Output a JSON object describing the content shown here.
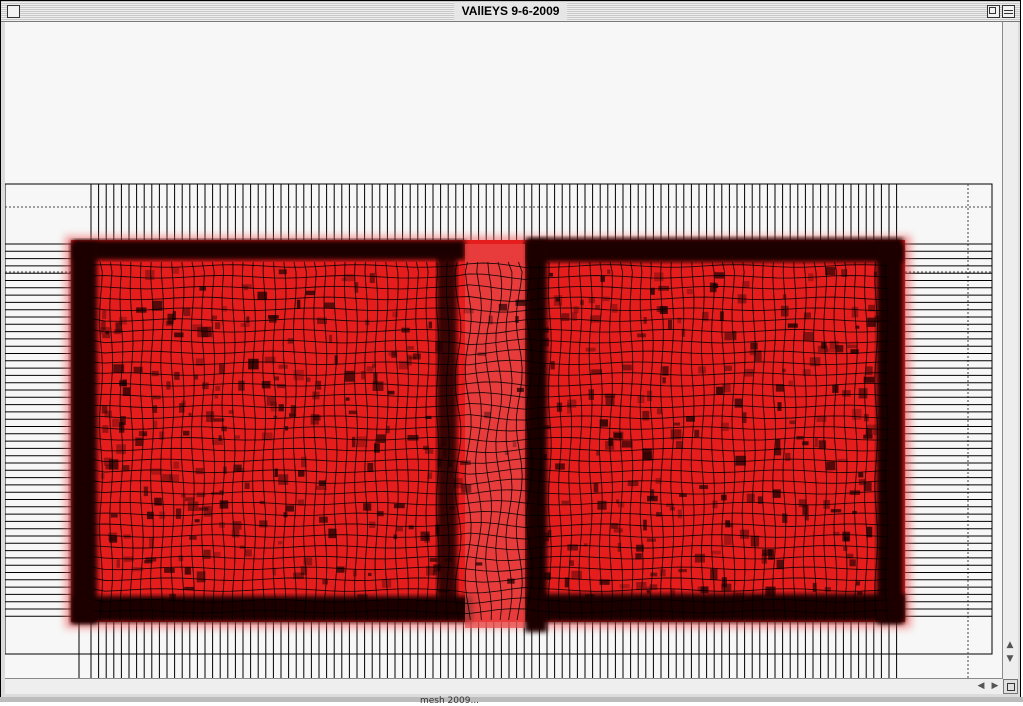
{
  "window": {
    "title": "VAllEYS 9-6-2009"
  },
  "canvas": {
    "description_icon": "warped-grid-red-fabric",
    "colors": {
      "fabric_red": "#e61d1d",
      "dark_spot": "#1a0000",
      "grid_line": "#000000",
      "background": "#f7f7f7"
    }
  },
  "scrollbars": {
    "up_icon": "▲",
    "down_icon": "▼",
    "left_icon": "◀",
    "right_icon": "▶"
  },
  "background_window": {
    "text": "mesh 2009..."
  }
}
